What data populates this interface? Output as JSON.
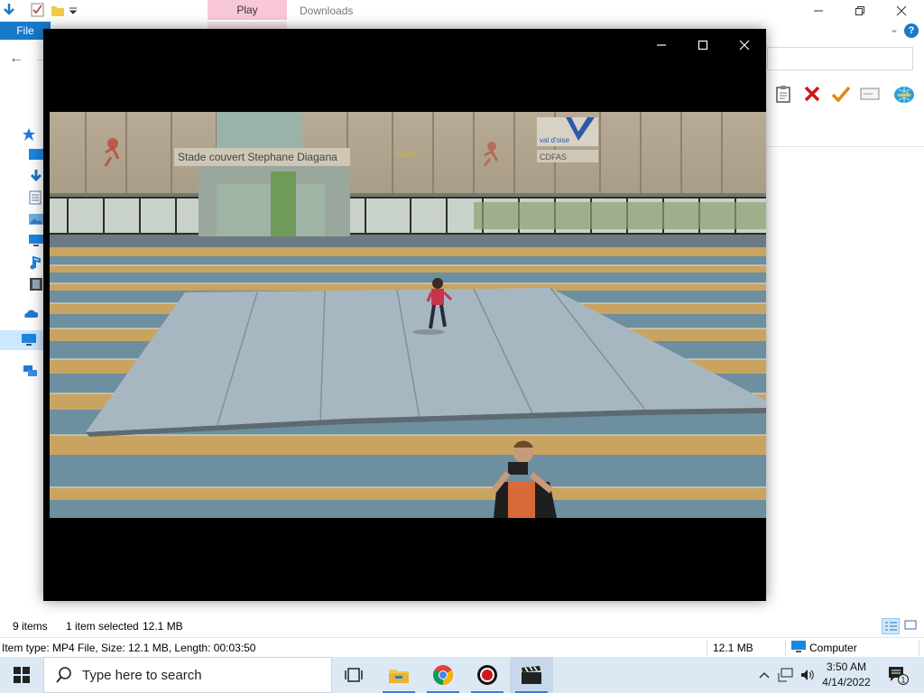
{
  "explorer": {
    "title": "Downloads",
    "ribbon": {
      "file_tab": "File",
      "play_tab": "Play",
      "help": "?"
    },
    "status": {
      "items": "9 items",
      "selected": "1 item selected",
      "size": "12.1 MB"
    },
    "infobar": {
      "details": "Item type: MP4 File, Size: 12.1 MB, Length: 00:03:50",
      "size": "12.1 MB",
      "location": "Computer"
    }
  },
  "player": {
    "video_scene": {
      "sign_main": "Stade couvert Stephane Diagana",
      "sign_brand": "val d'oise",
      "sign_sub": "CDFAS"
    }
  },
  "taskbar": {
    "search_placeholder": "Type here to search",
    "apps": [
      "task-view",
      "file-explorer",
      "chrome",
      "recorder",
      "video-player"
    ],
    "clock": {
      "time": "3:50 AM",
      "date": "4/14/2022"
    },
    "notifications": "1"
  },
  "colors": {
    "accent": "#1979ca",
    "play_tab": "#f8c7d9",
    "taskbar": "#dce9f5",
    "track_orange": "#c9a460",
    "track_blue": "#6d8fa0",
    "mat": "#a7b7c1"
  }
}
